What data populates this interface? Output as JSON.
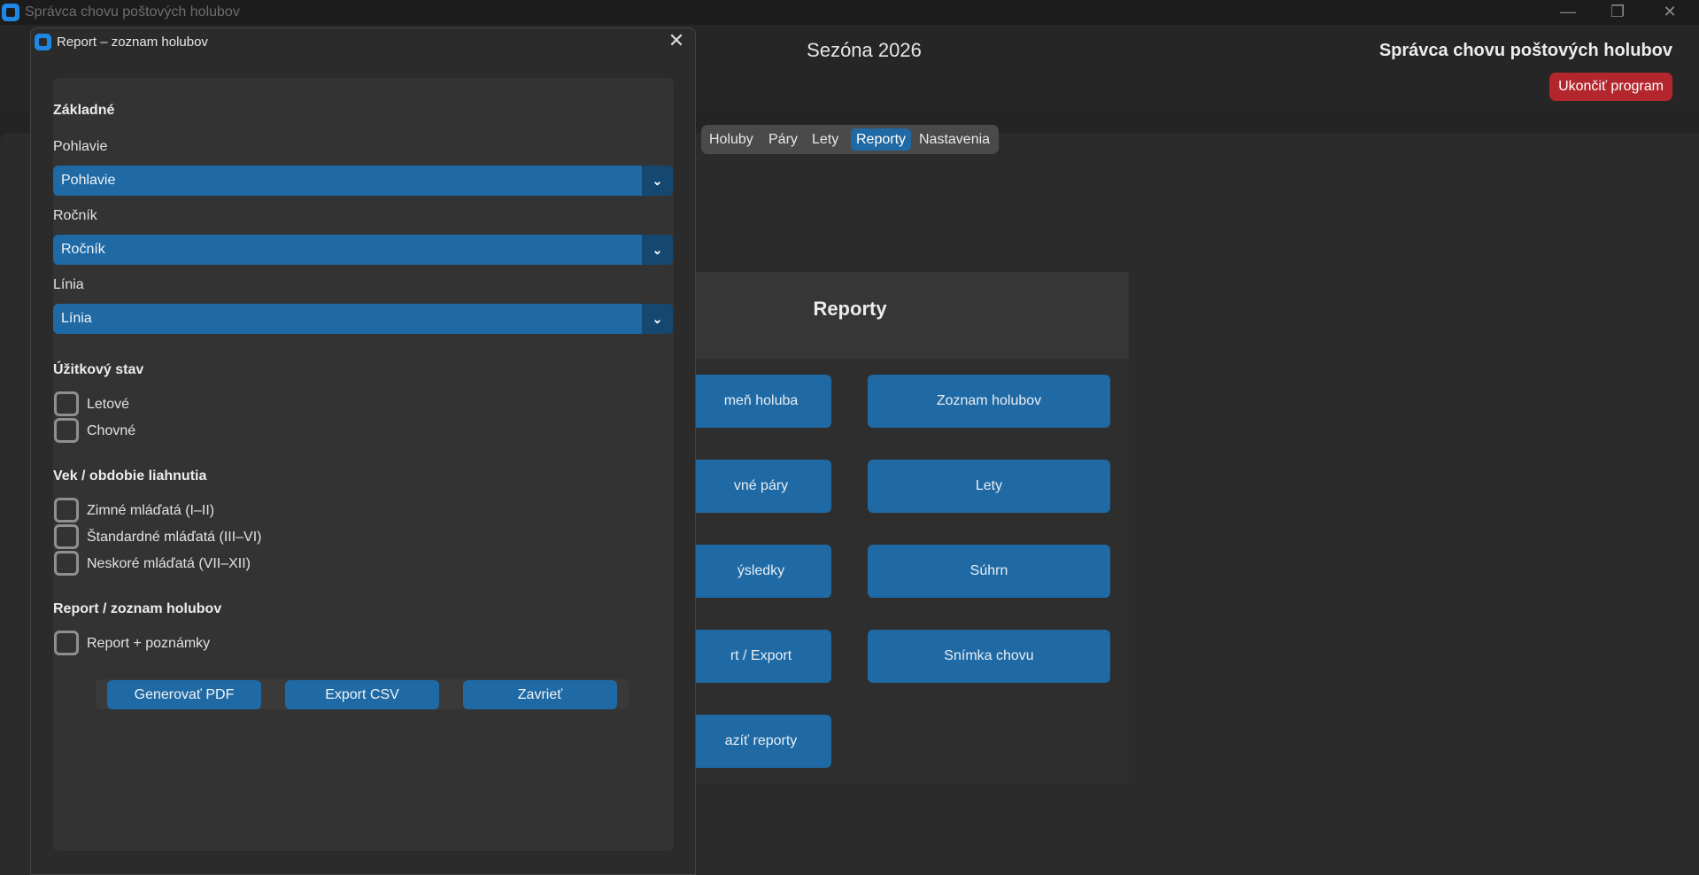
{
  "window": {
    "title": "Správca chovu poštových holubov"
  },
  "header": {
    "season": "Sezóna 2026",
    "brand": "Správca chovu poštových holubov",
    "quit_label": "Ukončiť program"
  },
  "tabs": [
    {
      "label": "Holuby"
    },
    {
      "label": "Páry"
    },
    {
      "label": "Lety"
    },
    {
      "label": "Reporty",
      "active": true
    },
    {
      "label": "Nastavenia"
    }
  ],
  "reports": {
    "title": "Reporty",
    "buttons": [
      "meň holuba",
      "Zoznam holubov",
      "vné páry",
      "Lety",
      "ýsledky",
      "Súhrn",
      "rt / Export",
      "Snímka chovu",
      "azíť reporty"
    ]
  },
  "dialog": {
    "title": "Report – zoznam holubov",
    "sections": {
      "basic": "Základné",
      "utility": "Úžitkový stav",
      "age": "Vek / obdobie liahnutia",
      "report": "Report / zoznam holubov"
    },
    "fields": {
      "sex_label": "Pohlavie",
      "sex_value": "Pohlavie",
      "year_label": "Ročník",
      "year_value": "Ročník",
      "line_label": "Línia",
      "line_value": "Línia"
    },
    "utility_options": [
      "Letové",
      "Chovné"
    ],
    "age_options": [
      "Zimné mláďatá (I–II)",
      "Štandardné mláďatá (III–VI)",
      "Neskoré mláďatá (VII–XII)"
    ],
    "report_options": [
      "Report + poznámky"
    ],
    "buttons": {
      "pdf": "Generovať PDF",
      "csv": "Export CSV",
      "close": "Zavrieť"
    }
  },
  "colors": {
    "accent": "#1f6aa5",
    "danger": "#b3262d",
    "background": "#242424"
  }
}
